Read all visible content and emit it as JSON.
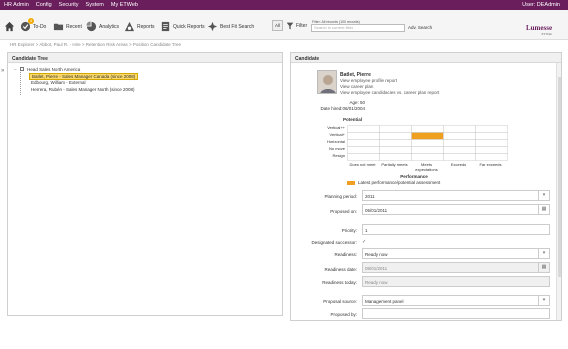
{
  "topbar": {
    "menu": [
      "HR Admin",
      "Config",
      "Security",
      "System",
      "My ETWeb"
    ],
    "user": "User: DEAdmin"
  },
  "toolbar": {
    "todo": "To-Do",
    "todo_badge": "4",
    "recent": "Recent",
    "analytics": "Analytics",
    "reports": "Reports",
    "quick_reports": "Quick Reports",
    "best_fit": "Best Fit Search",
    "all": "All",
    "filter": "Filter",
    "filter_caption": "Filter: All records (100 records)",
    "search_placeholder": "Search in current filter",
    "adv_search": "Adv. Search"
  },
  "logo": {
    "name": "Lumesse",
    "sub": "ETWeb"
  },
  "breadcrumb": "HR Explorer > Abbot, Paul R. - Hire > Retention Risk Areas > Position Candidate Tree",
  "candidate_tree": {
    "title": "Candidate Tree",
    "root": "Head Sales North America",
    "selected": "Batlet, Pierre - Sales Manager Canada (since 2008)",
    "items": [
      "Edbourg, William - External",
      "Herrera, Rubén - Sales Manager North (since 2008)"
    ]
  },
  "candidate": {
    "title": "Candidate",
    "name": "Batlet, Pierre",
    "links": [
      "View employee profile report",
      "View career plan",
      "View employee candidacies vs. career plan report"
    ],
    "age_label": "Age:",
    "age": "50",
    "date_hired_label": "Date hired:",
    "date_hired": "06/01/2004"
  },
  "chart_data": {
    "type": "heatmap",
    "title": "Potential",
    "ylabel": "Potential",
    "xlabel": "Performance",
    "y_categories": [
      "Vertical++",
      "Vertical+",
      "Horizontal",
      "No move",
      "Resign"
    ],
    "x_categories": [
      "Does not meet",
      "Partially meets",
      "Meets expectations",
      "Exceeds",
      "Far exceeds"
    ],
    "highlighted_cell": {
      "x": "Meets expectations",
      "y": "Vertical+"
    },
    "highlight_color": "#f0a020",
    "legend": "Latest performance/potential assessment"
  },
  "form": {
    "planning_period_label": "Planning period:",
    "planning_period": "2011",
    "proposed_on_label": "Proposed on:",
    "proposed_on": "05/01/2011",
    "priority_label": "Priority:",
    "priority": "1",
    "designated_successor_label": "Designated successor:",
    "designated_successor_check": "✓",
    "readiness_label": "Readiness:",
    "readiness": "Ready now",
    "readiness_date_label": "Readiness date:",
    "readiness_date": "05/01/2011",
    "readiness_today_label": "Readiness today:",
    "readiness_today": "Ready now",
    "proposal_source_label": "Proposal source:",
    "proposal_source": "Management panel",
    "proposed_by_label": "Proposed by:",
    "proposed_by": ""
  }
}
